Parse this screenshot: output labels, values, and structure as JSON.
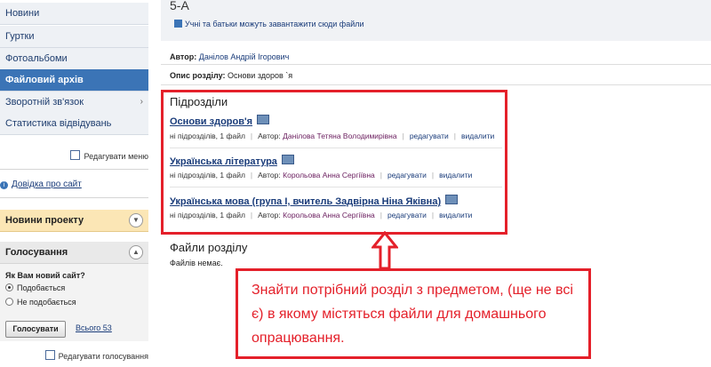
{
  "sidebar": {
    "items": [
      {
        "label": "Новини",
        "active": false
      },
      {
        "label": "Гуртки",
        "active": false
      },
      {
        "label": "Фотоальбоми",
        "active": false
      },
      {
        "label": "Файловий архів",
        "active": true
      },
      {
        "label": "Зворотній зв'язок",
        "active": false,
        "has_submenu": true
      },
      {
        "label": "Статистика відвідувань",
        "active": false
      }
    ],
    "edit_menu": "Редагувати меню",
    "help_link": "Довідка про сайт",
    "news_panel_title": "Новини проекту",
    "votes": {
      "title": "Голосування",
      "question": "Як Вам новий сайт?",
      "options": [
        "Подобається",
        "Не подобається"
      ],
      "selected_option": "Подобається",
      "submit": "Голосувати",
      "total": "Всього 53",
      "edit": "Редагувати голосування"
    }
  },
  "main": {
    "class_title": "5-А",
    "upload_note": "Учні та батьки можуть завантажити сюди файли",
    "author_label": "Автор:",
    "author_name": "Данілов Андрій Ігорович",
    "desc_label": "Опис розділу:",
    "desc_value": "Основи здоров `я",
    "subsections_title": "Підрозділи",
    "subsections": [
      {
        "title": "Основи здоров'я",
        "stats": "ні підрозділів, 1 файл",
        "author_label": "Автор:",
        "author": "Данілова Тетяна Володимирівна",
        "edit": "редагувати",
        "delete": "видалити"
      },
      {
        "title": "Українська література",
        "stats": "ні підрозділів, 1 файл",
        "author_label": "Автор:",
        "author": "Корольова Анна Сергіївна",
        "edit": "редагувати",
        "delete": "видалити"
      },
      {
        "title": "Українська мова (група I, вчитель Задвірна Ніна Яківна)",
        "stats": "ні підрозділів, 1 файл",
        "author_label": "Автор:",
        "author": "Корольова Анна Сергіївна",
        "edit": "редагувати",
        "delete": "видалити"
      }
    ],
    "files_title": "Файли розділу",
    "no_files": "Файлів немає."
  },
  "annotation": {
    "callout": "Знайти потрібний розділ з предметом, (ще не всі є) в якому містяться файли для домашнього опрацювання.",
    "color": "#e4202a"
  },
  "colors": {
    "accent": "#3b74b6",
    "link": "#1a3c7a",
    "news_panel": "#fbe6b5"
  }
}
